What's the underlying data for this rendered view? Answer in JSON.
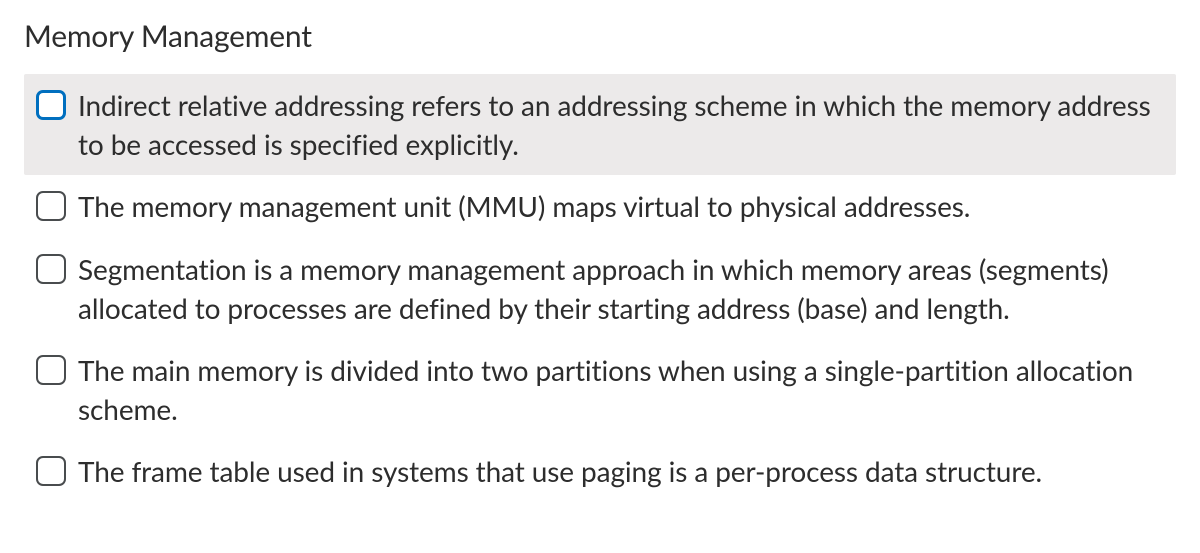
{
  "question": {
    "title": "Memory Management",
    "options": [
      {
        "text": "Indirect relative addressing refers to an addressing scheme in which the memory address to be accessed is specified explicitly.",
        "highlighted": true,
        "checked": false
      },
      {
        "text": "The memory management unit (MMU) maps virtual to physical addresses.",
        "highlighted": false,
        "checked": false
      },
      {
        "text": "Segmentation is a memory management approach in which memory areas (segments) allocated to processes are defined by their starting address (base) and length.",
        "highlighted": false,
        "checked": false
      },
      {
        "text": "The main memory is divided into two partitions when using a single-partition allocation scheme.",
        "highlighted": false,
        "checked": false
      },
      {
        "text": "The frame table used in systems that use paging is a per-process data structure.",
        "highlighted": false,
        "checked": false
      }
    ]
  }
}
